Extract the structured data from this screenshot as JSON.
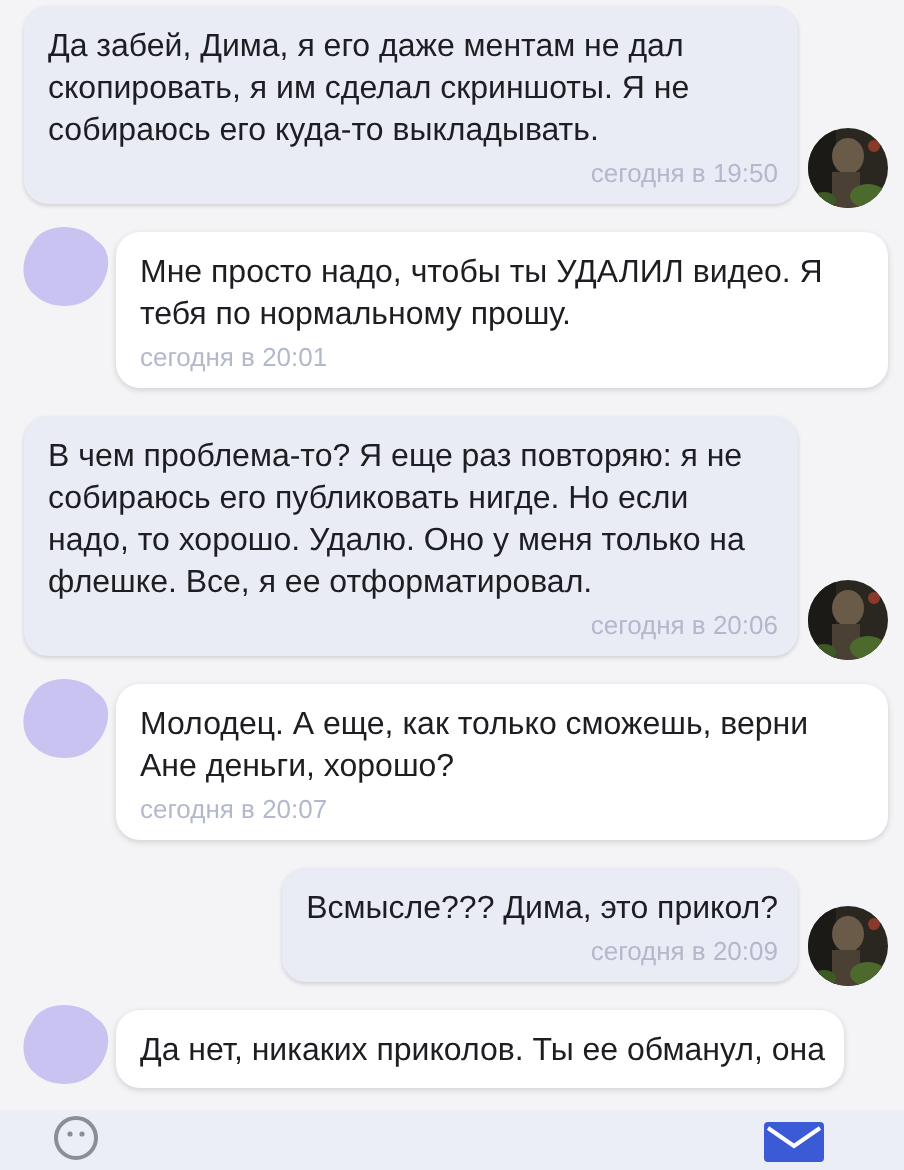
{
  "messages": [
    {
      "kind": "outgoing",
      "text": "Да забей, Дима, я его даже ментам не дал скопировать, я им сделал скриншоты. Я не собираюсь его куда-то выкладывать.",
      "time": "сегодня в 19:50"
    },
    {
      "kind": "incoming",
      "text": "Мне просто надо, чтобы ты УДАЛИЛ видео. Я тебя по нормальному прошу.",
      "time": "сегодня в 20:01"
    },
    {
      "kind": "outgoing",
      "text": "В чем проблема-то? Я еще раз повторяю: я не собираюсь его публиковать нигде. Но если надо, то хорошо. Удалю. Оно у меня только на флешке. Все, я ее отформатировал.",
      "time": "сегодня в 20:06"
    },
    {
      "kind": "incoming",
      "text": "Молодец. А еще, как только сможешь, верни Ане деньги, хорошо?",
      "time": "сегодня в 20:07"
    },
    {
      "kind": "outgoing",
      "text": "Всмысле??? Дима, это прикол?",
      "time": "сегодня в 20:09"
    },
    {
      "kind": "incoming",
      "text": "Да нет, никаких приколов. Ты ее обманул, она"
    }
  ]
}
